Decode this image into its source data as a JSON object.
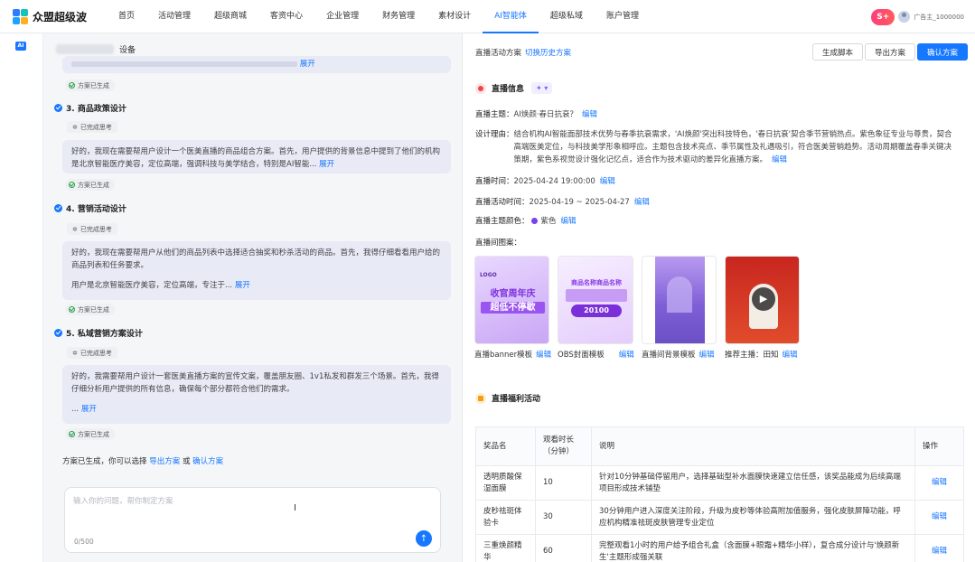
{
  "brand": {
    "name": "众盟超级波"
  },
  "nav": [
    "首页",
    "活动管理",
    "超级商城",
    "客资中心",
    "企业管理",
    "财务管理",
    "素材设计",
    "AI智能体",
    "超级私域",
    "账户管理"
  ],
  "nav_active_index": 7,
  "user": {
    "badge": "S+",
    "name": "广告主_1000000"
  },
  "rail": {
    "tag": "AI"
  },
  "chat": {
    "header_suffix": "设备",
    "intro_expand": "展开",
    "done_label": "方案已生成",
    "thinking_label": "已完成思考",
    "steps": [
      {
        "title": "3. 商品政策设计",
        "text": "好的，我现在需要帮用户设计一个医美直播的商品组合方案。首先，用户提供的背景信息中提到了他们的机构是北京智能医疗美容，定位高端，强调科技与美学结合，特别是AI智能...",
        "expand": "展开"
      },
      {
        "title": "4. 营销活动设计",
        "text": "好的，我现在需要帮用户从他们的商品列表中选择适合抽奖和秒杀活动的商品。首先，我得仔细看看用户给的商品列表和任务要求。",
        "text2": "用户是北京智能医疗美容，定位高端，专注于...",
        "expand": "展开"
      },
      {
        "title": "5. 私域营销方案设计",
        "text": "好的，我需要帮用户设计一套医美直播方案的宣传文案，覆盖朋友圈、1v1私发和群发三个场景。首先，我得仔细分析用户提供的所有信息，确保每个部分都符合他们的需求。",
        "text2": "...",
        "expand": "展开"
      }
    ],
    "final_prefix": "方案已生成，你可以选择",
    "final_export": "导出方案",
    "final_or": "或",
    "final_confirm": "确认方案",
    "input_placeholder": "输入你的问题，帮你制定方案",
    "counter": "0/500"
  },
  "panel": {
    "breadcrumb": "直播活动方案",
    "history_link": "切换历史方案",
    "buttons": {
      "generate": "生成脚本",
      "export": "导出方案",
      "confirm": "确认方案"
    },
    "live_info_title": "直播信息",
    "sparkle_label": "✦ ▾",
    "edit_label": "编辑",
    "theme_label": "直播主题：",
    "theme_value": "AI焕颜·春日抗衰？",
    "reason_label": "设计理由：",
    "reason_value": "结合机构AI智能面部技术优势与春季抗衰需求，'AI焕颜'突出科技特色，'春日抗衰'契合季节营销热点。紫色象征专业与尊贵，契合高端医美定位，与科技美学形象相呼应。主题包含技术亮点、季节属性及礼遇吸引，符合医美营销趋势。活动周期覆盖春季关键决策期，紫色系视觉设计强化记忆点，适合作为技术驱动的差异化直播方案。",
    "time_label": "直播时间：",
    "time_value": "2025-04-24 19:00:00",
    "period_label": "直播活动时间：",
    "period_value": "2025-04-19 ~ 2025-04-27",
    "color_label": "直播主题颜色：",
    "color_value": "紫色",
    "theme_color": "#7b3ff2",
    "images_label": "直播间图案：",
    "thumbs": [
      {
        "label": "直播banner模板",
        "text1": "LOGO",
        "text2": "收官周年庆",
        "text3": "超低不停歇"
      },
      {
        "label": "OBS封面模板",
        "text1": "商品名称商品名称",
        "text2": "20100"
      },
      {
        "label": "直播间背景模板"
      },
      {
        "label": "推荐主播：田知"
      }
    ],
    "welfare_title": "直播福利活动",
    "table": {
      "headers": [
        "奖品名",
        "观看时长（分钟）",
        "说明",
        "操作"
      ],
      "rows": [
        [
          "透明质酸保湿面膜",
          "10",
          "针对10分钟基础停留用户，选择基础型补水面膜快速建立信任感，该奖品能成为后续高端项目形成技术铺垫",
          "编辑"
        ],
        [
          "皮秒祛斑体验卡",
          "30",
          "30分钟用户进入深度关注阶段，升级为皮秒等体验高附加值服务，强化皮肤屏障功能，呼应机构精准祛斑皮肤管理专业定位",
          "编辑"
        ],
        [
          "三重焕颜精华",
          "60",
          "完整观看1小时的用户给予组合礼盒（含面膜+眼霜+精华小样），复合成分设计与'焕颜新生'主题形成强关联",
          "编辑"
        ]
      ]
    }
  }
}
